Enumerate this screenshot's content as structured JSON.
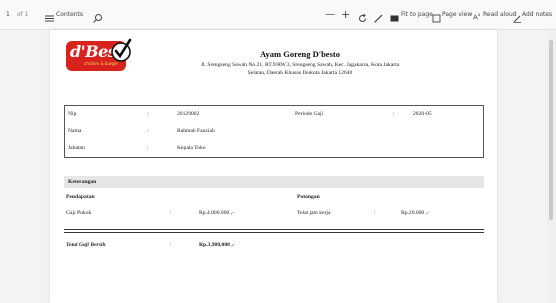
{
  "toolbar": {
    "page_current": "1",
    "page_total": "of 1",
    "contents_label": "Contents",
    "zoom_out": "—",
    "zoom_in": "+",
    "fit_label": "Fit to page",
    "page_view_label": "Page view",
    "read_aloud_label": "Read aloud",
    "add_notes_label": "Add notes",
    "icons": [
      "search-icon",
      "rotate-icon",
      "draw-icon",
      "fit-to-page-icon",
      "page-view-icon",
      "read-aloud-icon",
      "add-notes-icon",
      "print-icon",
      "save-icon",
      "save-as-icon",
      "favorite-icon"
    ]
  },
  "document": {
    "logo_text": "d'Besto",
    "logo_sub": "chicken & burger",
    "company_name": "Ayam Goreng D'besto",
    "address_line1": "Jl. Srengseng Sawah No.21, RT.9/RW.3, Srengseng Sawah, Kec. Jagakarsa, Kota Jakarta",
    "address_line2": "Selatan, Daerah Khusus Ibukota Jakarta 12640",
    "info": {
      "nip_label": "Nip",
      "nip_colon": ":",
      "nip_value": "20129002",
      "periode_label": "Periode Gaji",
      "periode_colon": ":",
      "periode_value": "2020-05",
      "nama_label": "Nama",
      "nama_colon": ":",
      "nama_value": "Rahmah Fauziah",
      "jabatan_label": "Jabatan",
      "jabatan_colon": ":",
      "jabatan_value": "Kepala Toko"
    },
    "keterangan_label": "Keterangan",
    "pendapatan_label": "Pendapatan",
    "potongan_label": "Potongan",
    "gaji_pokok_label": "Gaji Pokok",
    "gaji_pokok_colon": ":",
    "gaji_pokok_value": "Rp.4.000.000 ,-",
    "telat_label": "Telat jam kerja",
    "telat_colon": ":",
    "telat_value": "Rp.20.000 ,-",
    "total_label": "Total Gaji Bersih",
    "total_colon": ":",
    "total_value": "Rp.3,980,000 ,-"
  },
  "colors": {
    "logo_red": "#d8231d",
    "logo_yellow": "#ffd35a",
    "toolbar_bg": "#f9f9fb",
    "section_bar": "#e6e6e6"
  }
}
